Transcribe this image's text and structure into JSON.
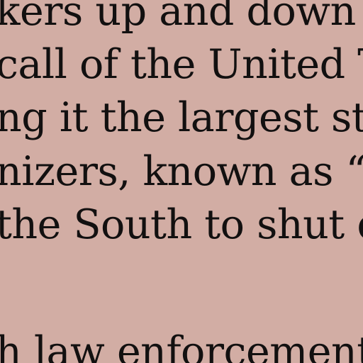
{
  "document": {
    "lines": [
      "kers up and down",
      "call of the United T",
      "ng it the largest stri",
      "nizers, known as “",
      "the South to shut d",
      "",
      "h law enforcement"
    ]
  },
  "colors": {
    "background": "#d2ada4",
    "text": "#121010"
  }
}
